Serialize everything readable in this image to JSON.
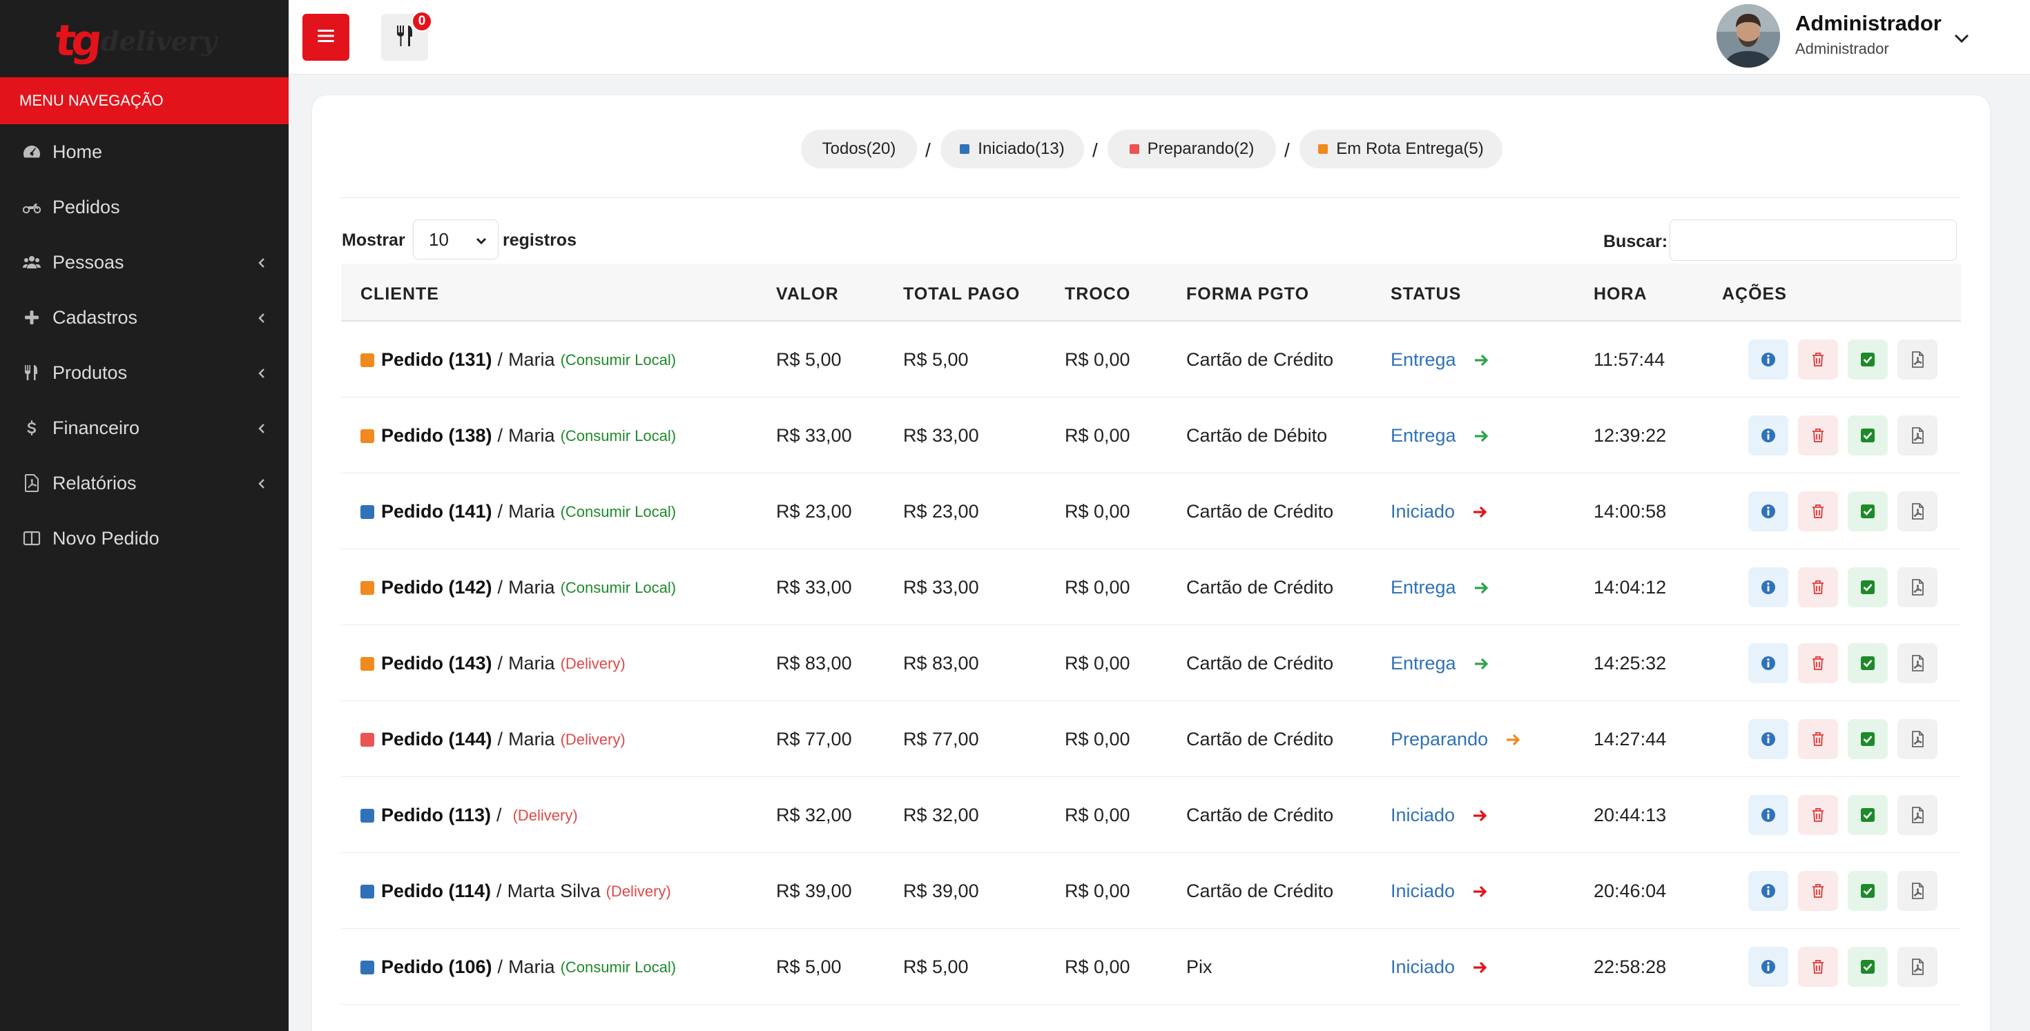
{
  "brand": {
    "logo_main": "tg",
    "logo_sub": "delivery",
    "logo_color": "#e3131b"
  },
  "sidebar": {
    "header": "MENU NAVEGAÇÃO",
    "items": [
      {
        "label": "Home",
        "icon": "dashboard-icon",
        "chevron": false
      },
      {
        "label": "Pedidos",
        "icon": "motorcycle-icon",
        "chevron": false
      },
      {
        "label": "Pessoas",
        "icon": "users-icon",
        "chevron": true
      },
      {
        "label": "Cadastros",
        "icon": "plus-icon",
        "chevron": true
      },
      {
        "label": "Produtos",
        "icon": "utensils-icon",
        "chevron": true
      },
      {
        "label": "Financeiro",
        "icon": "dollar-icon",
        "chevron": true
      },
      {
        "label": "Relatórios",
        "icon": "file-pdf-icon",
        "chevron": true
      },
      {
        "label": "Novo Pedido",
        "icon": "columns-icon",
        "chevron": false
      }
    ]
  },
  "topbar": {
    "cart_count": "0",
    "user_name": "Administrador",
    "user_role": "Administrador"
  },
  "filters": {
    "all": "Todos(20)",
    "started": "Iniciado(13)",
    "preparing": "Preparando(2)",
    "on_route": "Em Rota Entrega(5)",
    "separator": "/"
  },
  "table_controls": {
    "show_label": "Mostrar",
    "show_value": "10",
    "records_label": "registros",
    "search_label": "Buscar:",
    "search_value": ""
  },
  "colors": {
    "started": "#2f72b8",
    "preparing": "#ec5353",
    "on_route": "#f08a1f",
    "arrow_green": "#2fa34a",
    "arrow_red": "#e3131b",
    "arrow_orange": "#f08a1f"
  },
  "table": {
    "headers": [
      "CLIENTE",
      "VALOR",
      "TOTAL PAGO",
      "TROCO",
      "FORMA PGTO",
      "STATUS",
      "HORA",
      "AÇÕES"
    ],
    "rows": [
      {
        "color": "orange",
        "pedido": "Pedido (131)",
        "sep": "/",
        "cliente": "Maria",
        "tipo": "(Consumir Local)",
        "tipo_kind": "local",
        "valor": "R$ 5,00",
        "total": "R$ 5,00",
        "troco": "R$ 0,00",
        "forma": "Cartão de Crédito",
        "status": "Entrega",
        "arrow": "green",
        "hora": "11:57:44"
      },
      {
        "color": "orange",
        "pedido": "Pedido (138)",
        "sep": "/",
        "cliente": "Maria",
        "tipo": "(Consumir Local)",
        "tipo_kind": "local",
        "valor": "R$ 33,00",
        "total": "R$ 33,00",
        "troco": "R$ 0,00",
        "forma": "Cartão de Débito",
        "status": "Entrega",
        "arrow": "green",
        "hora": "12:39:22"
      },
      {
        "color": "blue",
        "pedido": "Pedido (141)",
        "sep": "/",
        "cliente": "Maria",
        "tipo": "(Consumir Local)",
        "tipo_kind": "local",
        "valor": "R$ 23,00",
        "total": "R$ 23,00",
        "troco": "R$ 0,00",
        "forma": "Cartão de Crédito",
        "status": "Iniciado",
        "arrow": "red",
        "hora": "14:00:58"
      },
      {
        "color": "orange",
        "pedido": "Pedido (142)",
        "sep": "/",
        "cliente": "Maria",
        "tipo": "(Consumir Local)",
        "tipo_kind": "local",
        "valor": "R$ 33,00",
        "total": "R$ 33,00",
        "troco": "R$ 0,00",
        "forma": "Cartão de Crédito",
        "status": "Entrega",
        "arrow": "green",
        "hora": "14:04:12"
      },
      {
        "color": "orange",
        "pedido": "Pedido (143)",
        "sep": "/",
        "cliente": "Maria",
        "tipo": "(Delivery)",
        "tipo_kind": "delivery",
        "valor": "R$ 83,00",
        "total": "R$ 83,00",
        "troco": "R$ 0,00",
        "forma": "Cartão de Crédito",
        "status": "Entrega",
        "arrow": "green",
        "hora": "14:25:32"
      },
      {
        "color": "red",
        "pedido": "Pedido (144)",
        "sep": "/",
        "cliente": "Maria",
        "tipo": "(Delivery)",
        "tipo_kind": "delivery",
        "valor": "R$ 77,00",
        "total": "R$ 77,00",
        "troco": "R$ 0,00",
        "forma": "Cartão de Crédito",
        "status": "Preparando",
        "arrow": "orange",
        "hora": "14:27:44"
      },
      {
        "color": "blue",
        "pedido": "Pedido (113)",
        "sep": "/",
        "cliente": "",
        "tipo": "(Delivery)",
        "tipo_kind": "delivery",
        "valor": "R$ 32,00",
        "total": "R$ 32,00",
        "troco": "R$ 0,00",
        "forma": "Cartão de Crédito",
        "status": "Iniciado",
        "arrow": "red",
        "hora": "20:44:13"
      },
      {
        "color": "blue",
        "pedido": "Pedido (114)",
        "sep": "/",
        "cliente": "Marta Silva",
        "tipo": "(Delivery)",
        "tipo_kind": "delivery",
        "valor": "R$ 39,00",
        "total": "R$ 39,00",
        "troco": "R$ 0,00",
        "forma": "Cartão de Crédito",
        "status": "Iniciado",
        "arrow": "red",
        "hora": "20:46:04"
      },
      {
        "color": "blue",
        "pedido": "Pedido (106)",
        "sep": "/",
        "cliente": "Maria",
        "tipo": "(Consumir Local)",
        "tipo_kind": "local",
        "valor": "R$ 5,00",
        "total": "R$ 5,00",
        "troco": "R$ 0,00",
        "forma": "Pix",
        "status": "Iniciado",
        "arrow": "red",
        "hora": "22:58:28"
      }
    ],
    "actions": [
      "info-icon",
      "trash-icon",
      "check-square-icon",
      "file-pdf-icon"
    ]
  }
}
